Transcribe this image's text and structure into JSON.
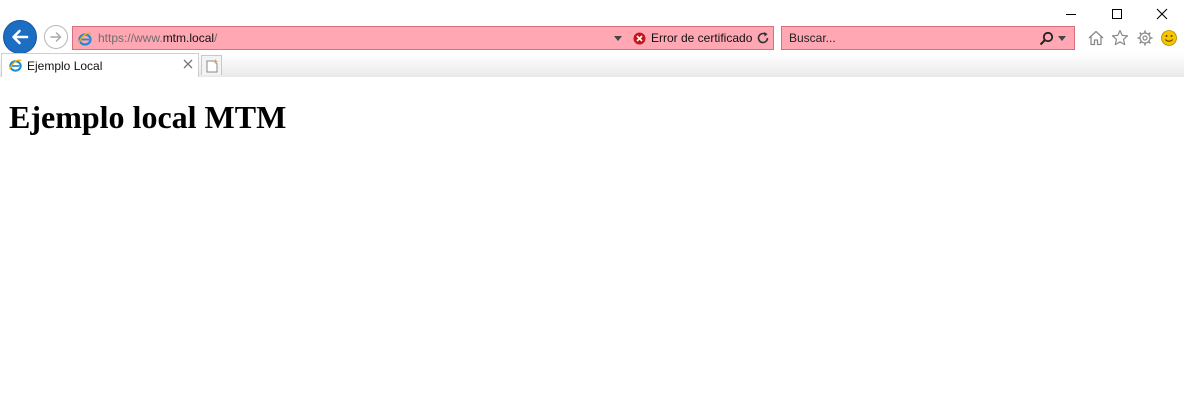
{
  "browser": {
    "address_bar": {
      "url_scheme": "https://www.",
      "url_host": "mtm.local",
      "url_path": "/",
      "certificate_status": "Error de certificado"
    },
    "search_bar": {
      "placeholder": "Buscar..."
    },
    "toolbar_icons": [
      "home-icon",
      "favorites-star-icon",
      "tools-gear-icon",
      "feedback-smiley-icon"
    ],
    "window_controls": [
      "minimize-icon",
      "maximize-icon",
      "close-icon"
    ],
    "tabs": [
      {
        "title": "Ejemplo Local",
        "active": true
      }
    ],
    "colors": {
      "cert_error_bg": "#ffa8b4",
      "back_button": "#1b6ec2",
      "cert_error_icon": "#c4161c"
    }
  },
  "page": {
    "heading": "Ejemplo local MTM"
  }
}
